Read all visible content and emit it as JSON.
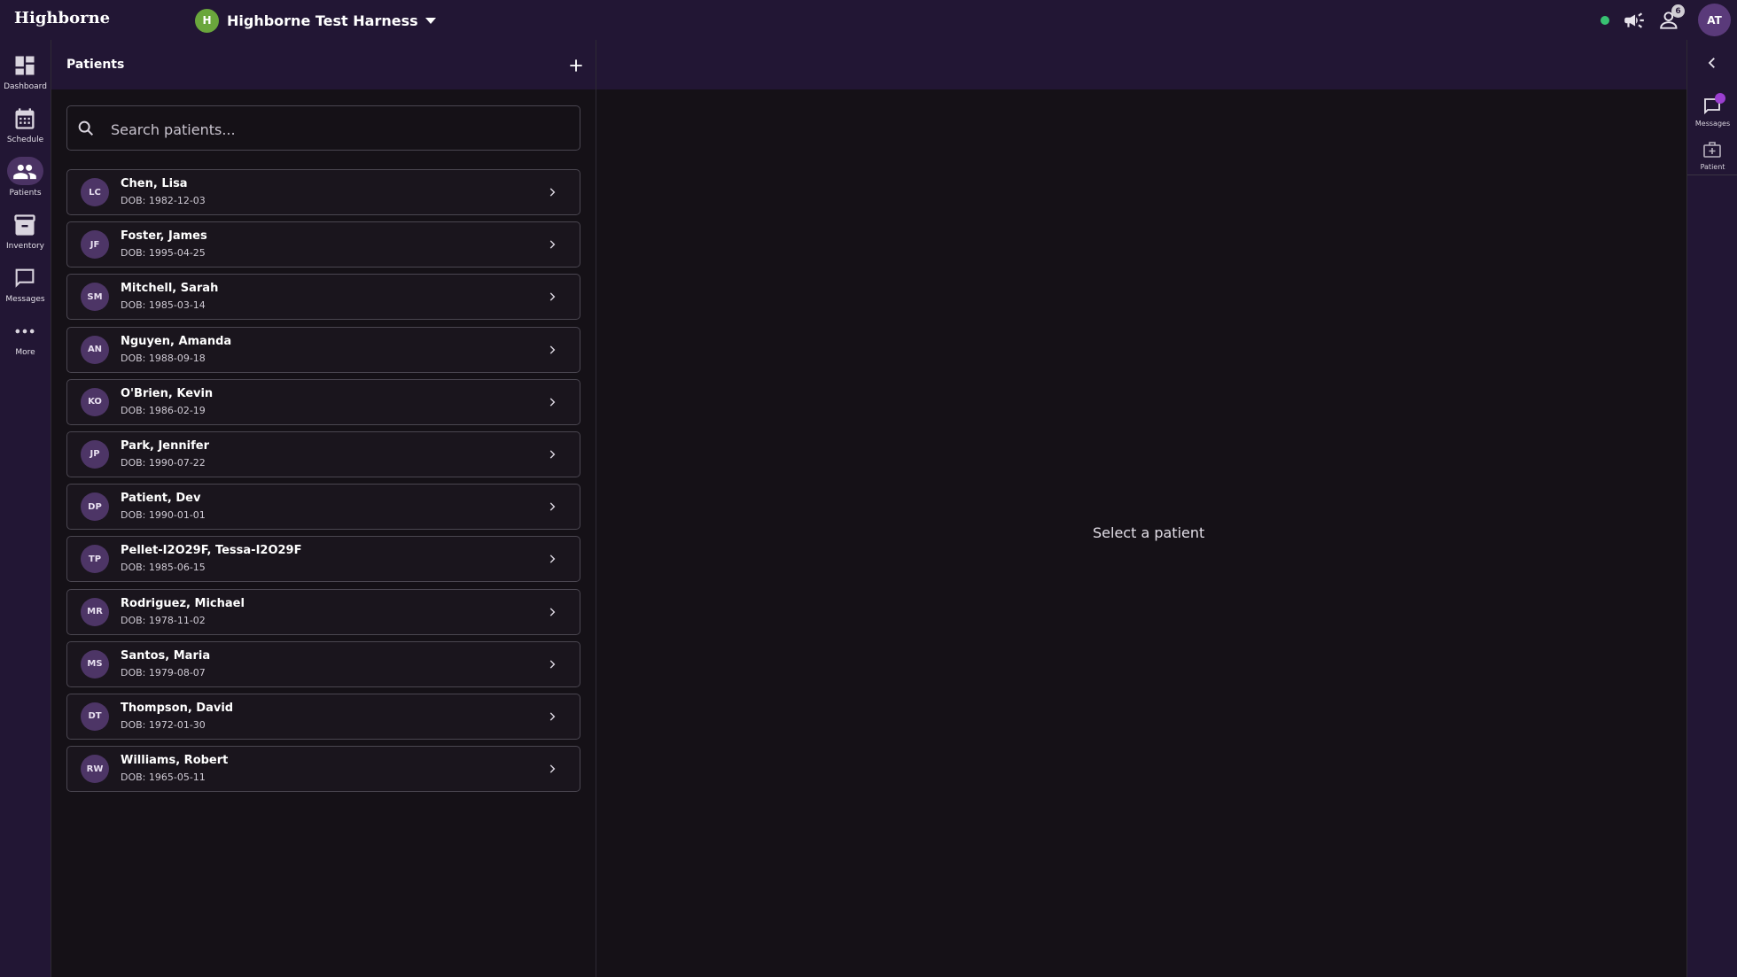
{
  "app": {
    "brand": "Highborne",
    "org": {
      "initial": "H",
      "name": "Highborne Test Harness"
    },
    "notifications_badge": "6",
    "user_initials": "AT"
  },
  "left_nav": [
    {
      "id": "dashboard",
      "label": "Dashboard",
      "icon": "dashboard-icon"
    },
    {
      "id": "schedule",
      "label": "Schedule",
      "icon": "calendar-icon"
    },
    {
      "id": "patients",
      "label": "Patients",
      "icon": "people-icon",
      "active": true
    },
    {
      "id": "inventory",
      "label": "Inventory",
      "icon": "archive-box-icon"
    },
    {
      "id": "messages",
      "label": "Messages",
      "icon": "chat-icon"
    },
    {
      "id": "more",
      "label": "More",
      "icon": "more-horizontal-icon"
    }
  ],
  "patients_panel": {
    "title": "Patients",
    "search_placeholder": "Search patients...",
    "patients": [
      {
        "initials": "LC",
        "name": "Chen, Lisa",
        "dob": "DOB: 1982-12-03"
      },
      {
        "initials": "JF",
        "name": "Foster, James",
        "dob": "DOB: 1995-04-25"
      },
      {
        "initials": "SM",
        "name": "Mitchell, Sarah",
        "dob": "DOB: 1985-03-14"
      },
      {
        "initials": "AN",
        "name": "Nguyen, Amanda",
        "dob": "DOB: 1988-09-18"
      },
      {
        "initials": "KO",
        "name": "O'Brien, Kevin",
        "dob": "DOB: 1986-02-19"
      },
      {
        "initials": "JP",
        "name": "Park, Jennifer",
        "dob": "DOB: 1990-07-22"
      },
      {
        "initials": "DP",
        "name": "Patient, Dev",
        "dob": "DOB: 1990-01-01"
      },
      {
        "initials": "TP",
        "name": "Pellet-I2O29F, Tessa-I2O29F",
        "dob": "DOB: 1985-06-15"
      },
      {
        "initials": "MR",
        "name": "Rodriguez, Michael",
        "dob": "DOB: 1978-11-02"
      },
      {
        "initials": "MS",
        "name": "Santos, Maria",
        "dob": "DOB: 1979-08-07"
      },
      {
        "initials": "DT",
        "name": "Thompson, David",
        "dob": "DOB: 1972-01-30"
      },
      {
        "initials": "RW",
        "name": "Williams, Robert",
        "dob": "DOB: 1965-05-11"
      }
    ]
  },
  "main": {
    "empty_text": "Select a patient"
  },
  "right_nav": [
    {
      "id": "messages",
      "label": "Messages",
      "icon": "chat-icon",
      "has_badge": true
    },
    {
      "id": "patient",
      "label": "Patient",
      "icon": "medical-bag-icon"
    }
  ],
  "colors": {
    "topbar": "#221634",
    "background": "#151117",
    "accent": "#4b3364",
    "status_online": "#38c172",
    "org_avatar": "#6aa63c",
    "badge_purple": "#9b3fd0"
  }
}
